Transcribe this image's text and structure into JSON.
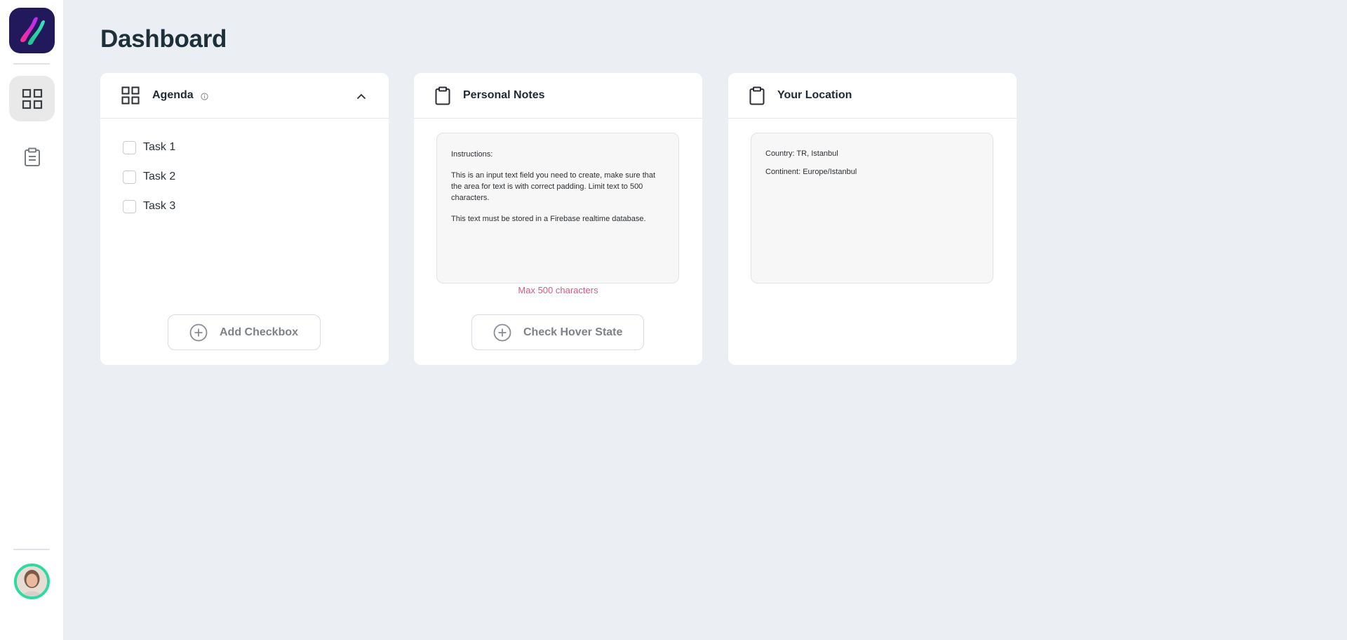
{
  "page": {
    "title": "Dashboard"
  },
  "sidebar": {
    "items": [
      {
        "name": "dashboard",
        "icon": "grid-icon",
        "active": true
      },
      {
        "name": "notes",
        "icon": "clipboard-icon",
        "active": false
      }
    ]
  },
  "agenda": {
    "title": "Agenda",
    "tasks": [
      {
        "label": "Task 1",
        "checked": false
      },
      {
        "label": "Task 2",
        "checked": false
      },
      {
        "label": "Task 3",
        "checked": false
      }
    ],
    "add_button_label": "Add Checkbox"
  },
  "notes": {
    "title": "Personal Notes",
    "text_lines": [
      "Instructions:",
      "This is an input text field you need to create, make sure that the area for text is with correct padding. Limit text to 500 characters.",
      "This text must be stored in a Firebase realtime database."
    ],
    "max_label": "Max 500 characters",
    "button_label": "Check Hover State"
  },
  "location": {
    "title": "Your Location",
    "country": "Country: TR, Istanbul",
    "continent": "Continent: Europe/Istanbul"
  },
  "colors": {
    "background": "#ebeef3",
    "avatar_ring": "#2fd9a0",
    "logo_bg": "#21195c",
    "warning_text": "#d65a7c"
  }
}
